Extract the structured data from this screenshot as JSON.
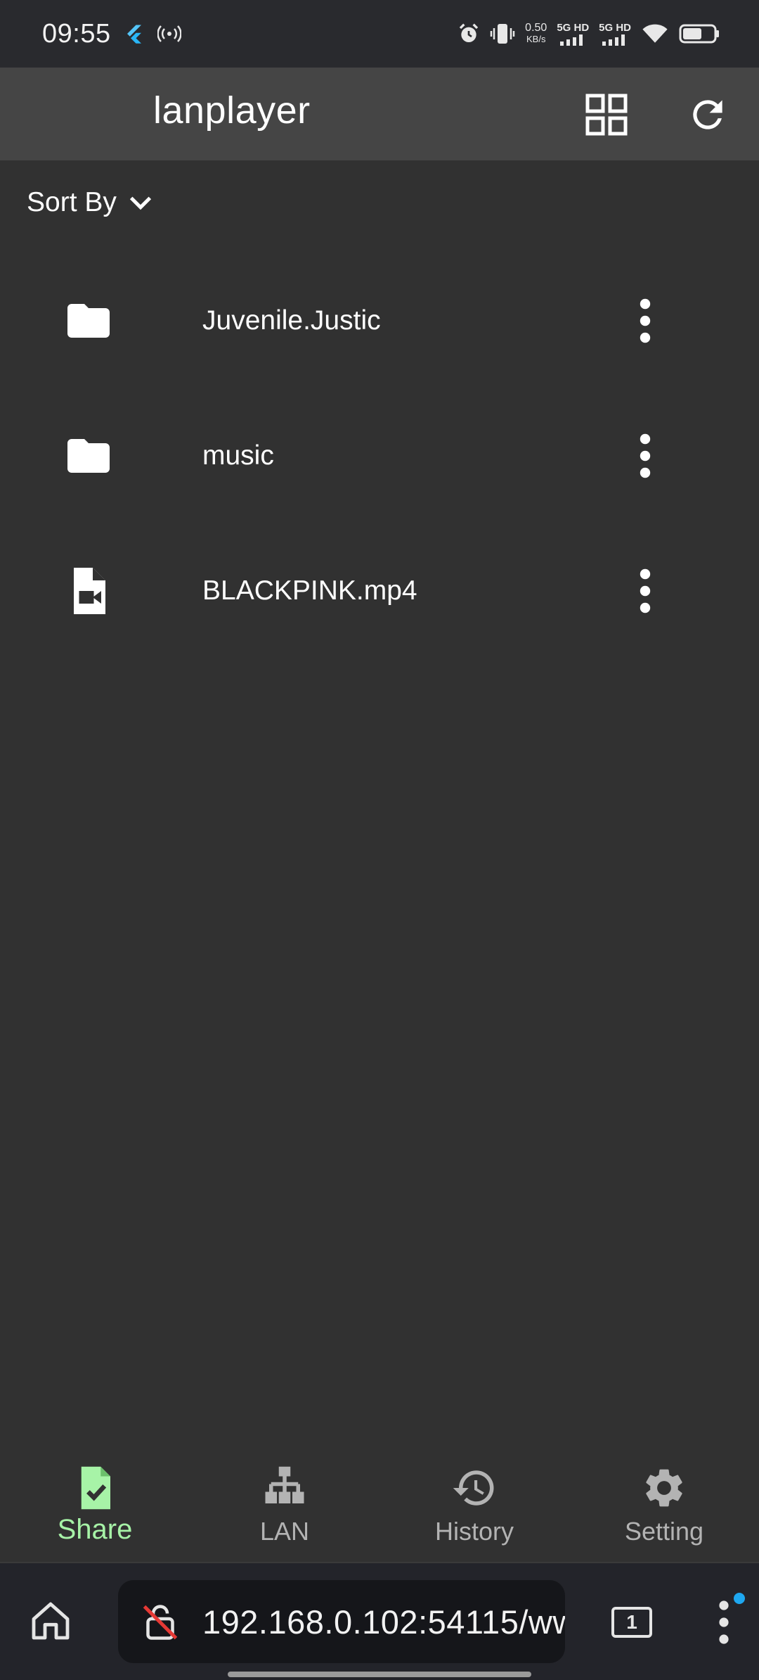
{
  "status_bar": {
    "time": "09:55",
    "net_speed_value": "0.50",
    "net_speed_unit": "KB/s",
    "signal1_label": "5G HD",
    "signal2_label": "5G HD"
  },
  "app_bar": {
    "title": "lanplayer"
  },
  "sort": {
    "label": "Sort By"
  },
  "files": [
    {
      "name": "Juvenile.Justic",
      "type": "folder"
    },
    {
      "name": "music",
      "type": "folder"
    },
    {
      "name": "BLACKPINK.mp4",
      "type": "video-file"
    }
  ],
  "bottom_nav": {
    "items": [
      {
        "label": "Share",
        "icon": "share-check-icon",
        "active": true
      },
      {
        "label": "LAN",
        "icon": "network-icon",
        "active": false
      },
      {
        "label": "History",
        "icon": "history-icon",
        "active": false
      },
      {
        "label": "Setting",
        "icon": "gear-icon",
        "active": false
      }
    ]
  },
  "browser": {
    "url": "192.168.0.102:54115/ww",
    "tab_count": "1"
  },
  "colors": {
    "background": "#313131",
    "app_bar": "#454545",
    "active_nav": "#a7f3a7",
    "inactive_nav": "#b3b3b3",
    "notification_dot": "#1ea7f0"
  }
}
